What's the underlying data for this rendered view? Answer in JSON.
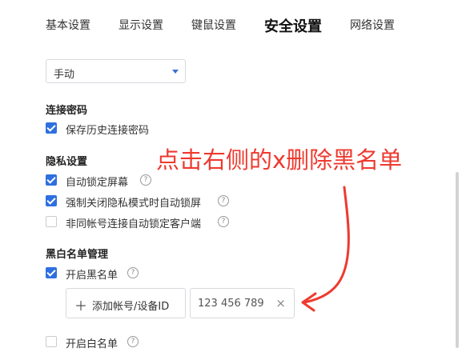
{
  "tabs": [
    {
      "label": "基本设置"
    },
    {
      "label": "显示设置"
    },
    {
      "label": "键鼠设置"
    },
    {
      "label": "安全设置",
      "active": true
    },
    {
      "label": "网络设置"
    }
  ],
  "mode_select": {
    "value": "手动"
  },
  "sections": {
    "connection_password": {
      "title": "连接密码",
      "options": [
        {
          "label": "保存历史连接密码",
          "checked": true
        }
      ]
    },
    "privacy": {
      "title": "隐私设置",
      "options": [
        {
          "label": "自动锁定屏幕",
          "checked": true
        },
        {
          "label": "强制关闭隐私模式时自动锁屏",
          "checked": true
        },
        {
          "label": "非同帐号连接自动锁定客户端",
          "checked": false
        }
      ]
    },
    "blackwhite": {
      "title": "黑白名单管理",
      "blacklist_label": "开启黑名单",
      "blacklist_checked": true,
      "add_button_label": "添加帐号/设备ID",
      "entries": [
        {
          "id": "123 456 789"
        }
      ],
      "whitelist_label": "开启白名单",
      "whitelist_checked": false
    }
  },
  "icons": {
    "help": "?",
    "plus": "＋",
    "remove": "×"
  },
  "annotation": {
    "text": "点击右侧的x删除黑名单",
    "color": "#ee3a2f"
  },
  "colors": {
    "accent": "#2f6fe0",
    "border": "#d6d9de"
  }
}
